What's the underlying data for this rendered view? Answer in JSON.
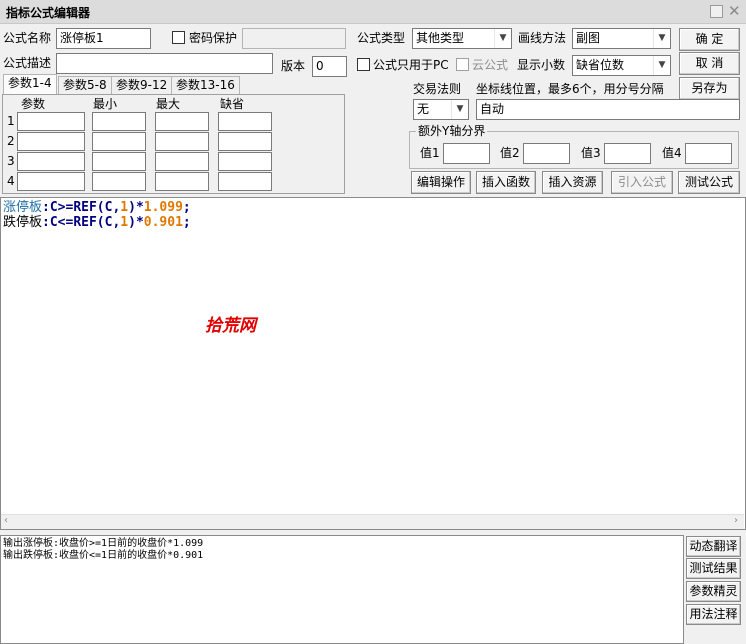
{
  "window": {
    "title": "指标公式编辑器"
  },
  "form": {
    "name_label": "公式名称",
    "name_value": "涨停板1",
    "password_label": "密码保护",
    "desc_label": "公式描述",
    "desc_value": "",
    "version_label": "版本",
    "version_value": "0",
    "type_label": "公式类型",
    "type_value": "其他类型",
    "draw_label": "画线方法",
    "draw_value": "副图",
    "pc_only_label": "公式只用于PC",
    "cloud_label": "云公式",
    "decimals_label": "显示小数",
    "decimals_value": "缺省位数",
    "trade_rule_label": "交易法则",
    "trade_rule_value": "无",
    "coord_label": "坐标线位置，最多6个，用分号分隔",
    "coord_value": "自动"
  },
  "buttons": {
    "ok": "确  定",
    "cancel": "取  消",
    "save_as": "另存为",
    "edit_op": "编辑操作",
    "insert_func": "插入函数",
    "insert_res": "插入资源",
    "import_formula": "引入公式",
    "test_formula": "测试公式",
    "dyn_translate": "动态翻译",
    "test_result": "测试结果",
    "param_wizard": "参数精灵",
    "usage_notes": "用法注释"
  },
  "tabs": [
    {
      "label": "参数1-4"
    },
    {
      "label": "参数5-8"
    },
    {
      "label": "参数9-12"
    },
    {
      "label": "参数13-16"
    }
  ],
  "params": {
    "col_param": "参数",
    "col_min": "最小",
    "col_max": "最大",
    "col_default": "缺省",
    "rows": [
      "1",
      "2",
      "3",
      "4"
    ]
  },
  "yaxis": {
    "group_label": "额外Y轴分界",
    "v1_label": "值1",
    "v2_label": "值2",
    "v3_label": "值3",
    "v4_label": "值4"
  },
  "code": {
    "line1_name": "涨停板",
    "line1_a": ":C>=REF(C,",
    "line1_n": "1",
    "line1_b": ")*",
    "line1_v": "1.099",
    "line1_end": ";",
    "line2_name": "跌停板",
    "line2_a": ":C<=REF(C,",
    "line2_n": "1",
    "line2_b": ")*",
    "line2_v": "0.901",
    "line2_end": ";",
    "watermark": "拾荒网"
  },
  "output": {
    "line1": "输出涨停板:收盘价>=1日前的收盘价*1.099",
    "line2": "输出跌停板:收盘价<=1日前的收盘价*0.901"
  },
  "colors": {
    "keyword_blue": "#1e6fa8",
    "func_green": "#008000",
    "number_orange": "#e07800",
    "operator_navy": "#000080",
    "watermark_red": "#e00000"
  }
}
